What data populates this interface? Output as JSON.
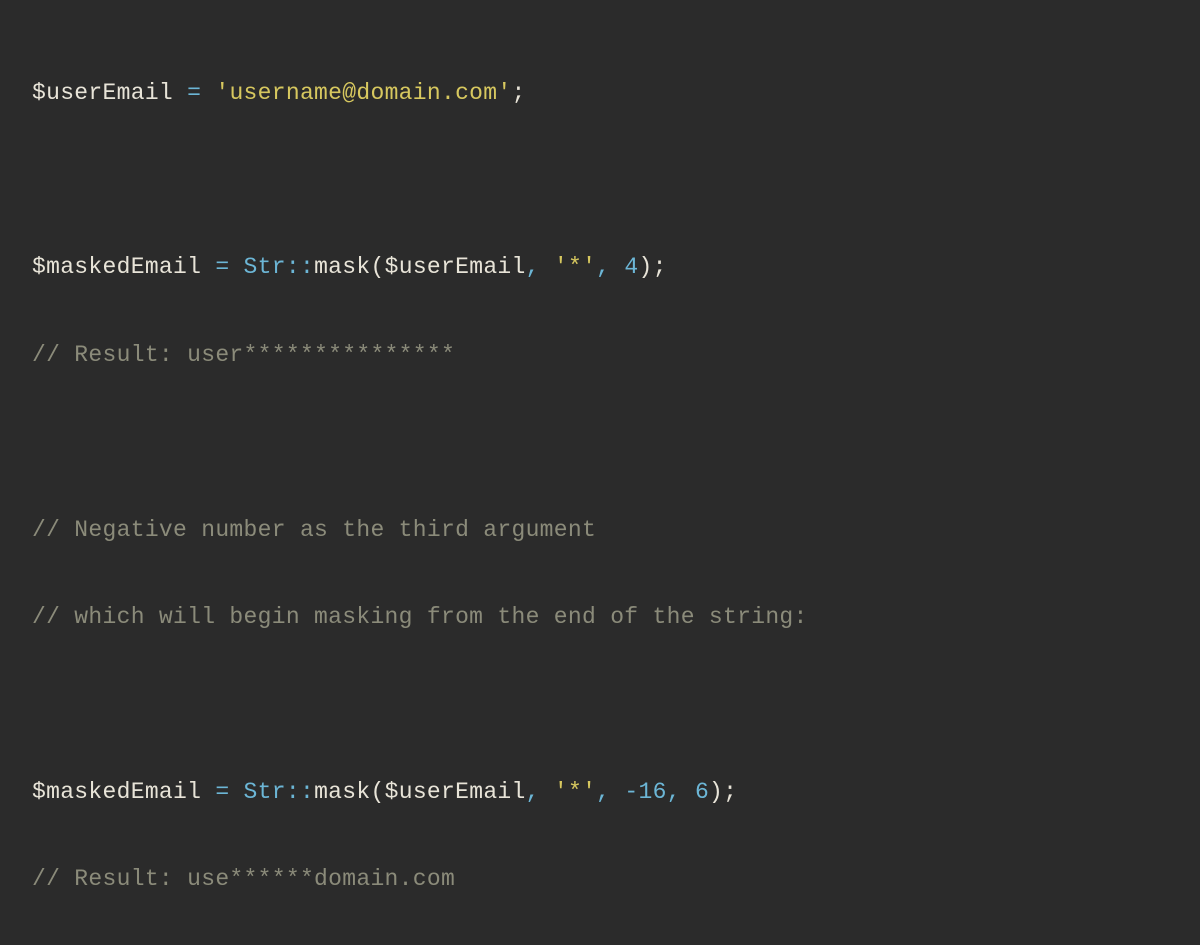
{
  "line1": {
    "var": "$userEmail",
    "op": " = ",
    "string": "'username@domain.com'",
    "semi": ";"
  },
  "line2": {
    "var": "$maskedEmail",
    "op": " = ",
    "class": "Str",
    "dcolon": "::",
    "method": "mask",
    "lparen": "(",
    "arg1": "$userEmail",
    "comma1": ", ",
    "arg2": "'*'",
    "comma2": ", ",
    "arg3": "4",
    "rparen": ")",
    "semi": ";"
  },
  "line3": {
    "comment": "// Result: user***************"
  },
  "line4": {
    "comment": "// Negative number as the third argument"
  },
  "line5": {
    "comment": "// which will begin masking from the end of the string:"
  },
  "line6": {
    "var": "$maskedEmail",
    "op": " = ",
    "class": "Str",
    "dcolon": "::",
    "method": "mask",
    "lparen": "(",
    "arg1": "$userEmail",
    "comma1": ", ",
    "arg2": "'*'",
    "comma2": ", ",
    "sign3": "-",
    "arg3": "16",
    "comma3": ", ",
    "arg4": "6",
    "rparen": ")",
    "semi": ";"
  },
  "line7": {
    "comment": "// Result: use******domain.com"
  }
}
